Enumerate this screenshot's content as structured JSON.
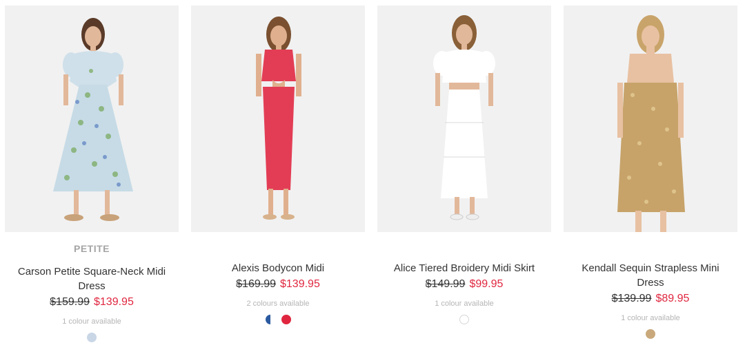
{
  "products": [
    {
      "badge": "PETITE",
      "name": "Carson Petite Square-Neck Midi Dress",
      "price_old": "$159.99",
      "price_new": "$139.95",
      "colours_text": "1 colour available",
      "swatch_colors": [
        "#c9d6e6"
      ]
    },
    {
      "badge": "",
      "name": "Alexis Bodycon Midi",
      "price_old": "$169.99",
      "price_new": "$139.95",
      "colours_text": "2 colours available",
      "swatch_colors": [
        "#2c5aa0",
        "#e0263f"
      ]
    },
    {
      "badge": "",
      "name": "Alice Tiered Broidery Midi Skirt",
      "price_old": "$149.99",
      "price_new": "$99.95",
      "colours_text": "1 colour available",
      "swatch_colors": [
        "#ffffff"
      ]
    },
    {
      "badge": "",
      "name": "Kendall Sequin Strapless Mini Dress",
      "price_old": "$139.99",
      "price_new": "$89.95",
      "colours_text": "1 colour available",
      "swatch_colors": [
        "#c9a97c"
      ]
    }
  ],
  "colors": {
    "sale_price": "#e0263f",
    "image_bg": "#f1f1f1"
  }
}
